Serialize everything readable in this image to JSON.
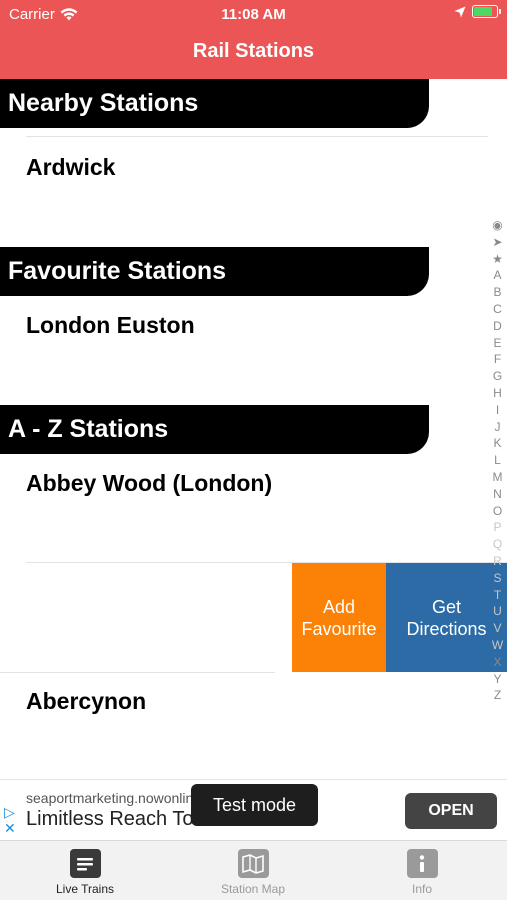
{
  "status_bar": {
    "carrier": "Carrier",
    "time": "11:08 AM",
    "battery_color": "#4cd964"
  },
  "nav": {
    "title": "Rail Stations",
    "background": "#ec5555"
  },
  "sections": [
    {
      "title": "Nearby Stations",
      "rows": [
        "Ardwick"
      ]
    },
    {
      "title": "Favourite Stations",
      "rows": [
        "London Euston"
      ]
    },
    {
      "title": "A - Z Stations",
      "rows": [
        "Abbey Wood (London)",
        "Abercynon"
      ]
    }
  ],
  "swipe_actions": {
    "add_favourite": {
      "line1": "Add",
      "line2": "Favourite",
      "color": "#fc8207"
    },
    "get_directions": {
      "line1": "Get",
      "line2": "Directions",
      "color": "#2c6ba5"
    }
  },
  "index_bar": [
    "◉",
    "➤",
    "★",
    "A",
    "B",
    "C",
    "D",
    "E",
    "F",
    "G",
    "H",
    "I",
    "J",
    "K",
    "L",
    "M",
    "N",
    "O",
    "P",
    "Q",
    "R",
    "S",
    "T",
    "U",
    "V",
    "W",
    "X",
    "Y",
    "Z"
  ],
  "ad": {
    "url": "seaportmarketing.nowonline",
    "headline": "Limitless Reach To",
    "toast": "Test mode",
    "cta": "OPEN"
  },
  "tabs": [
    {
      "label": "Live Trains",
      "icon": "live-trains-icon",
      "active": true
    },
    {
      "label": "Station Map",
      "icon": "station-map-icon",
      "active": false
    },
    {
      "label": "Info",
      "icon": "info-icon",
      "active": false
    }
  ]
}
